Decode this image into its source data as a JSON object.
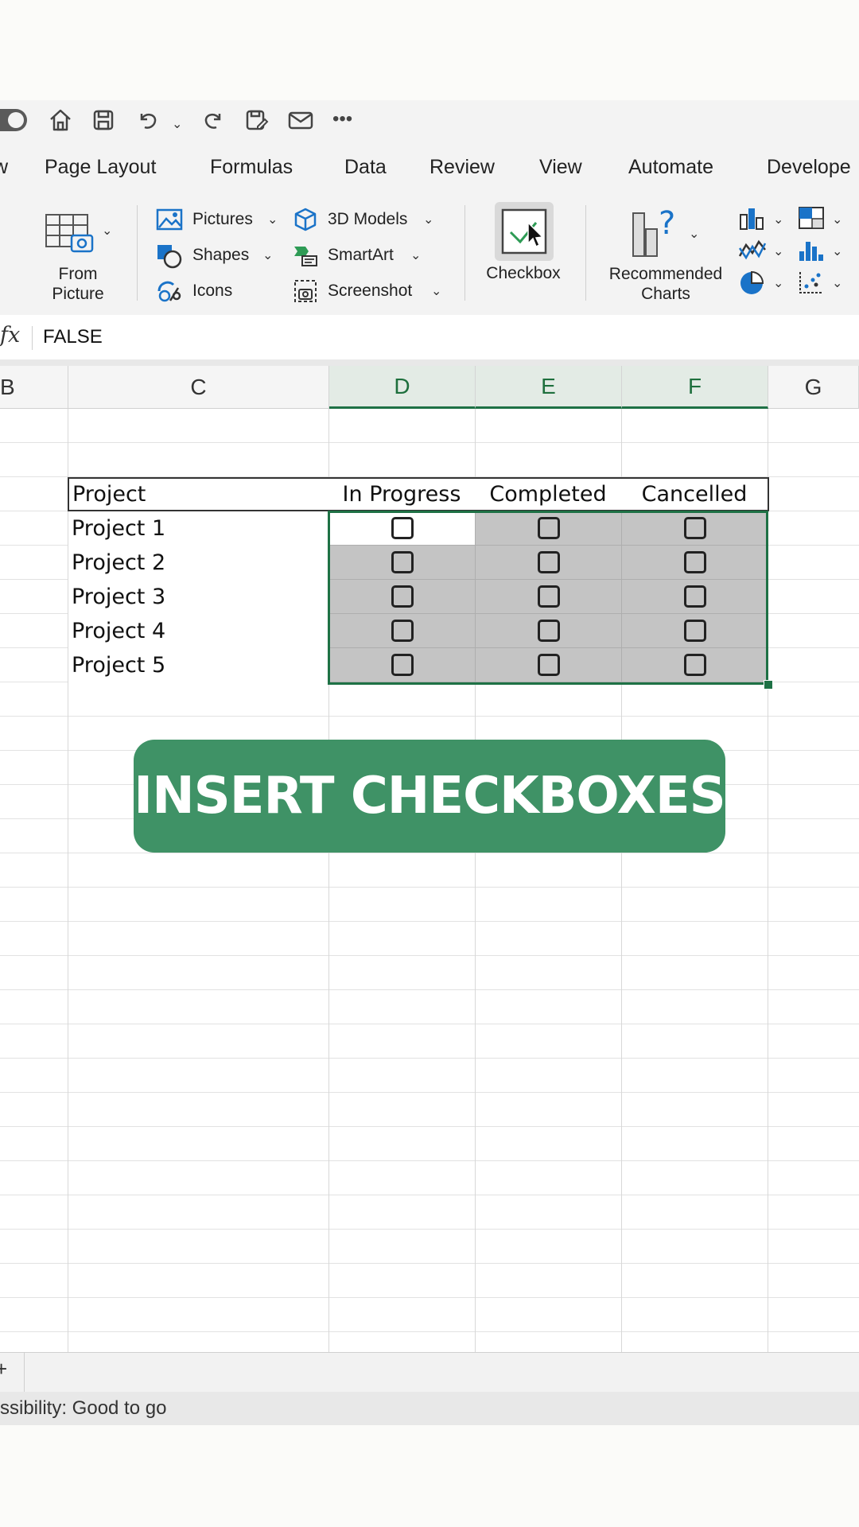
{
  "menu": {
    "tabs": [
      {
        "label": "w"
      },
      {
        "label": "Page Layout"
      },
      {
        "label": "Formulas"
      },
      {
        "label": "Data"
      },
      {
        "label": "Review"
      },
      {
        "label": "View"
      },
      {
        "label": "Automate"
      },
      {
        "label": "Develope"
      }
    ]
  },
  "ribbon": {
    "from_picture": "From\nPicture",
    "pictures": "Pictures",
    "shapes": "Shapes",
    "icons": "Icons",
    "models_3d": "3D Models",
    "smartart": "SmartArt",
    "screenshot": "Screenshot",
    "checkbox": "Checkbox",
    "recommended_charts": "Recommended\nCharts"
  },
  "formula_bar": {
    "fx": "fx",
    "value": "FALSE"
  },
  "columns": [
    "B",
    "C",
    "D",
    "E",
    "F",
    "G"
  ],
  "table": {
    "headers": [
      "Project",
      "In Progress",
      "Completed",
      "Cancelled"
    ],
    "rows": [
      {
        "name": "Project 1"
      },
      {
        "name": "Project 2"
      },
      {
        "name": "Project 3"
      },
      {
        "name": "Project 4"
      },
      {
        "name": "Project 5"
      }
    ]
  },
  "banner": {
    "text": "INSERT CHECKBOXES"
  },
  "status": {
    "text": "ssibility: Good to go",
    "sheet_add": "+"
  },
  "colors": {
    "accent": "#3f9266",
    "selection": "#1e7145"
  }
}
